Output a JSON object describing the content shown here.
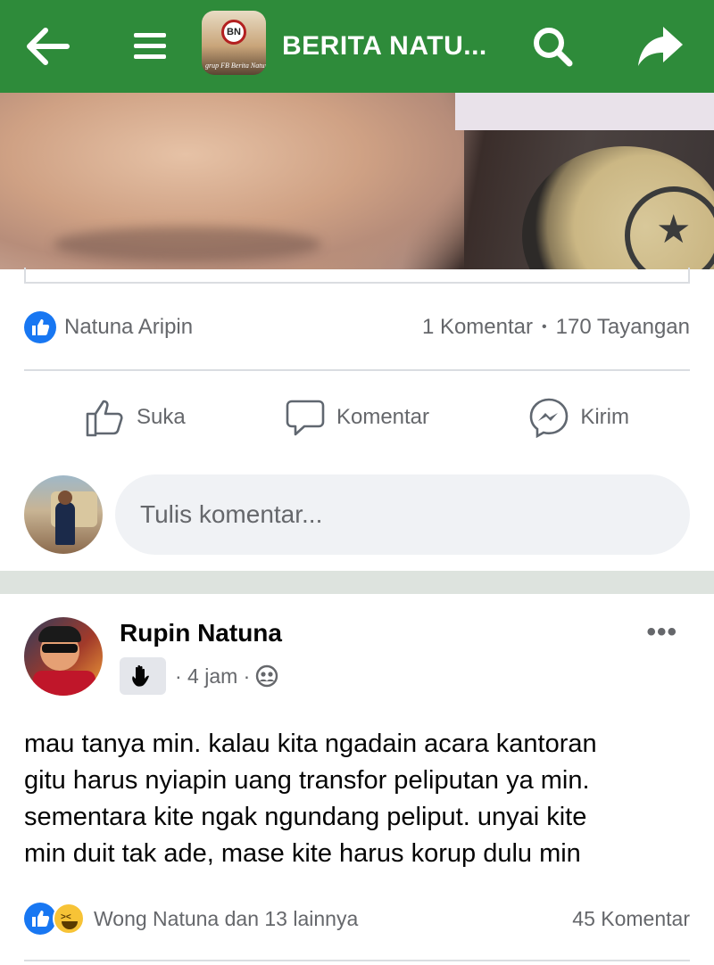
{
  "header": {
    "title": "BERITA NATU...",
    "logo_text": "BN",
    "logo_tagline": "grup FB Berita Natuna",
    "bar_color": "#2e8b3a",
    "back_icon": "arrow-left-icon",
    "menu_icon": "hamburger-icon",
    "search_icon": "search-icon",
    "share_icon": "share-arrow-icon"
  },
  "post1": {
    "reactor_name": "Natuna Aripin",
    "comment_count": "1 Komentar",
    "dot": "•",
    "views": "170 Tayangan",
    "actions": {
      "like": "Suka",
      "comment": "Komentar",
      "send": "Kirim"
    },
    "composer_placeholder": "Tulis komentar..."
  },
  "post2": {
    "author": "Rupin Natuna",
    "badge_icon": "wave-hand-icon",
    "time": "· 4 jam ·",
    "audience_icon": "group-icon",
    "more": "•••",
    "text_lines": [
      "mau tanya min. kalau kita ngadain acara kantoran",
      "gitu harus nyiapin uang transfor peliputan ya min.",
      "sementara kite ngak ngundang peliput. unyai kite",
      "min duit tak ade, mase kite harus korup dulu min"
    ],
    "reactions": "Wong Natuna dan 13 lainnya",
    "comment_count": "45 Komentar"
  },
  "colors": {
    "facebook_blue": "#1877f2",
    "muted_text": "#65676b",
    "divider": "#dadde1"
  }
}
